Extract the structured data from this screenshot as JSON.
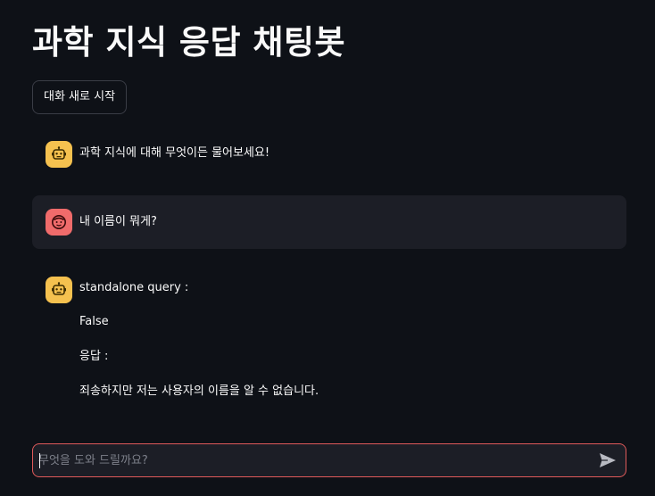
{
  "app": {
    "title": "과학 지식 응답 채팅봇"
  },
  "controls": {
    "reset_label": "대화 새로 시작"
  },
  "messages": [
    {
      "role": "assistant",
      "avatar_icon": "robot-icon",
      "lines": [
        "과학 지식에 대해 무엇이든 물어보세요!"
      ]
    },
    {
      "role": "user",
      "avatar_icon": "face-icon",
      "lines": [
        "내 이름이 뭐게?"
      ]
    },
    {
      "role": "assistant",
      "avatar_icon": "robot-icon",
      "lines": [
        "standalone query :",
        "False",
        "응답 :",
        "죄송하지만 저는 사용자의 이름을 알 수 없습니다."
      ]
    }
  ],
  "chat_input": {
    "placeholder": "무엇을 도와 드릴까요?",
    "value": "",
    "send_icon": "send-icon"
  },
  "colors": {
    "background": "#0e1117",
    "user_message_bg": "#1c1e26",
    "bot_avatar": "#f5c14f",
    "user_avatar": "#f06b6b",
    "input_border": "#e05a5a"
  }
}
